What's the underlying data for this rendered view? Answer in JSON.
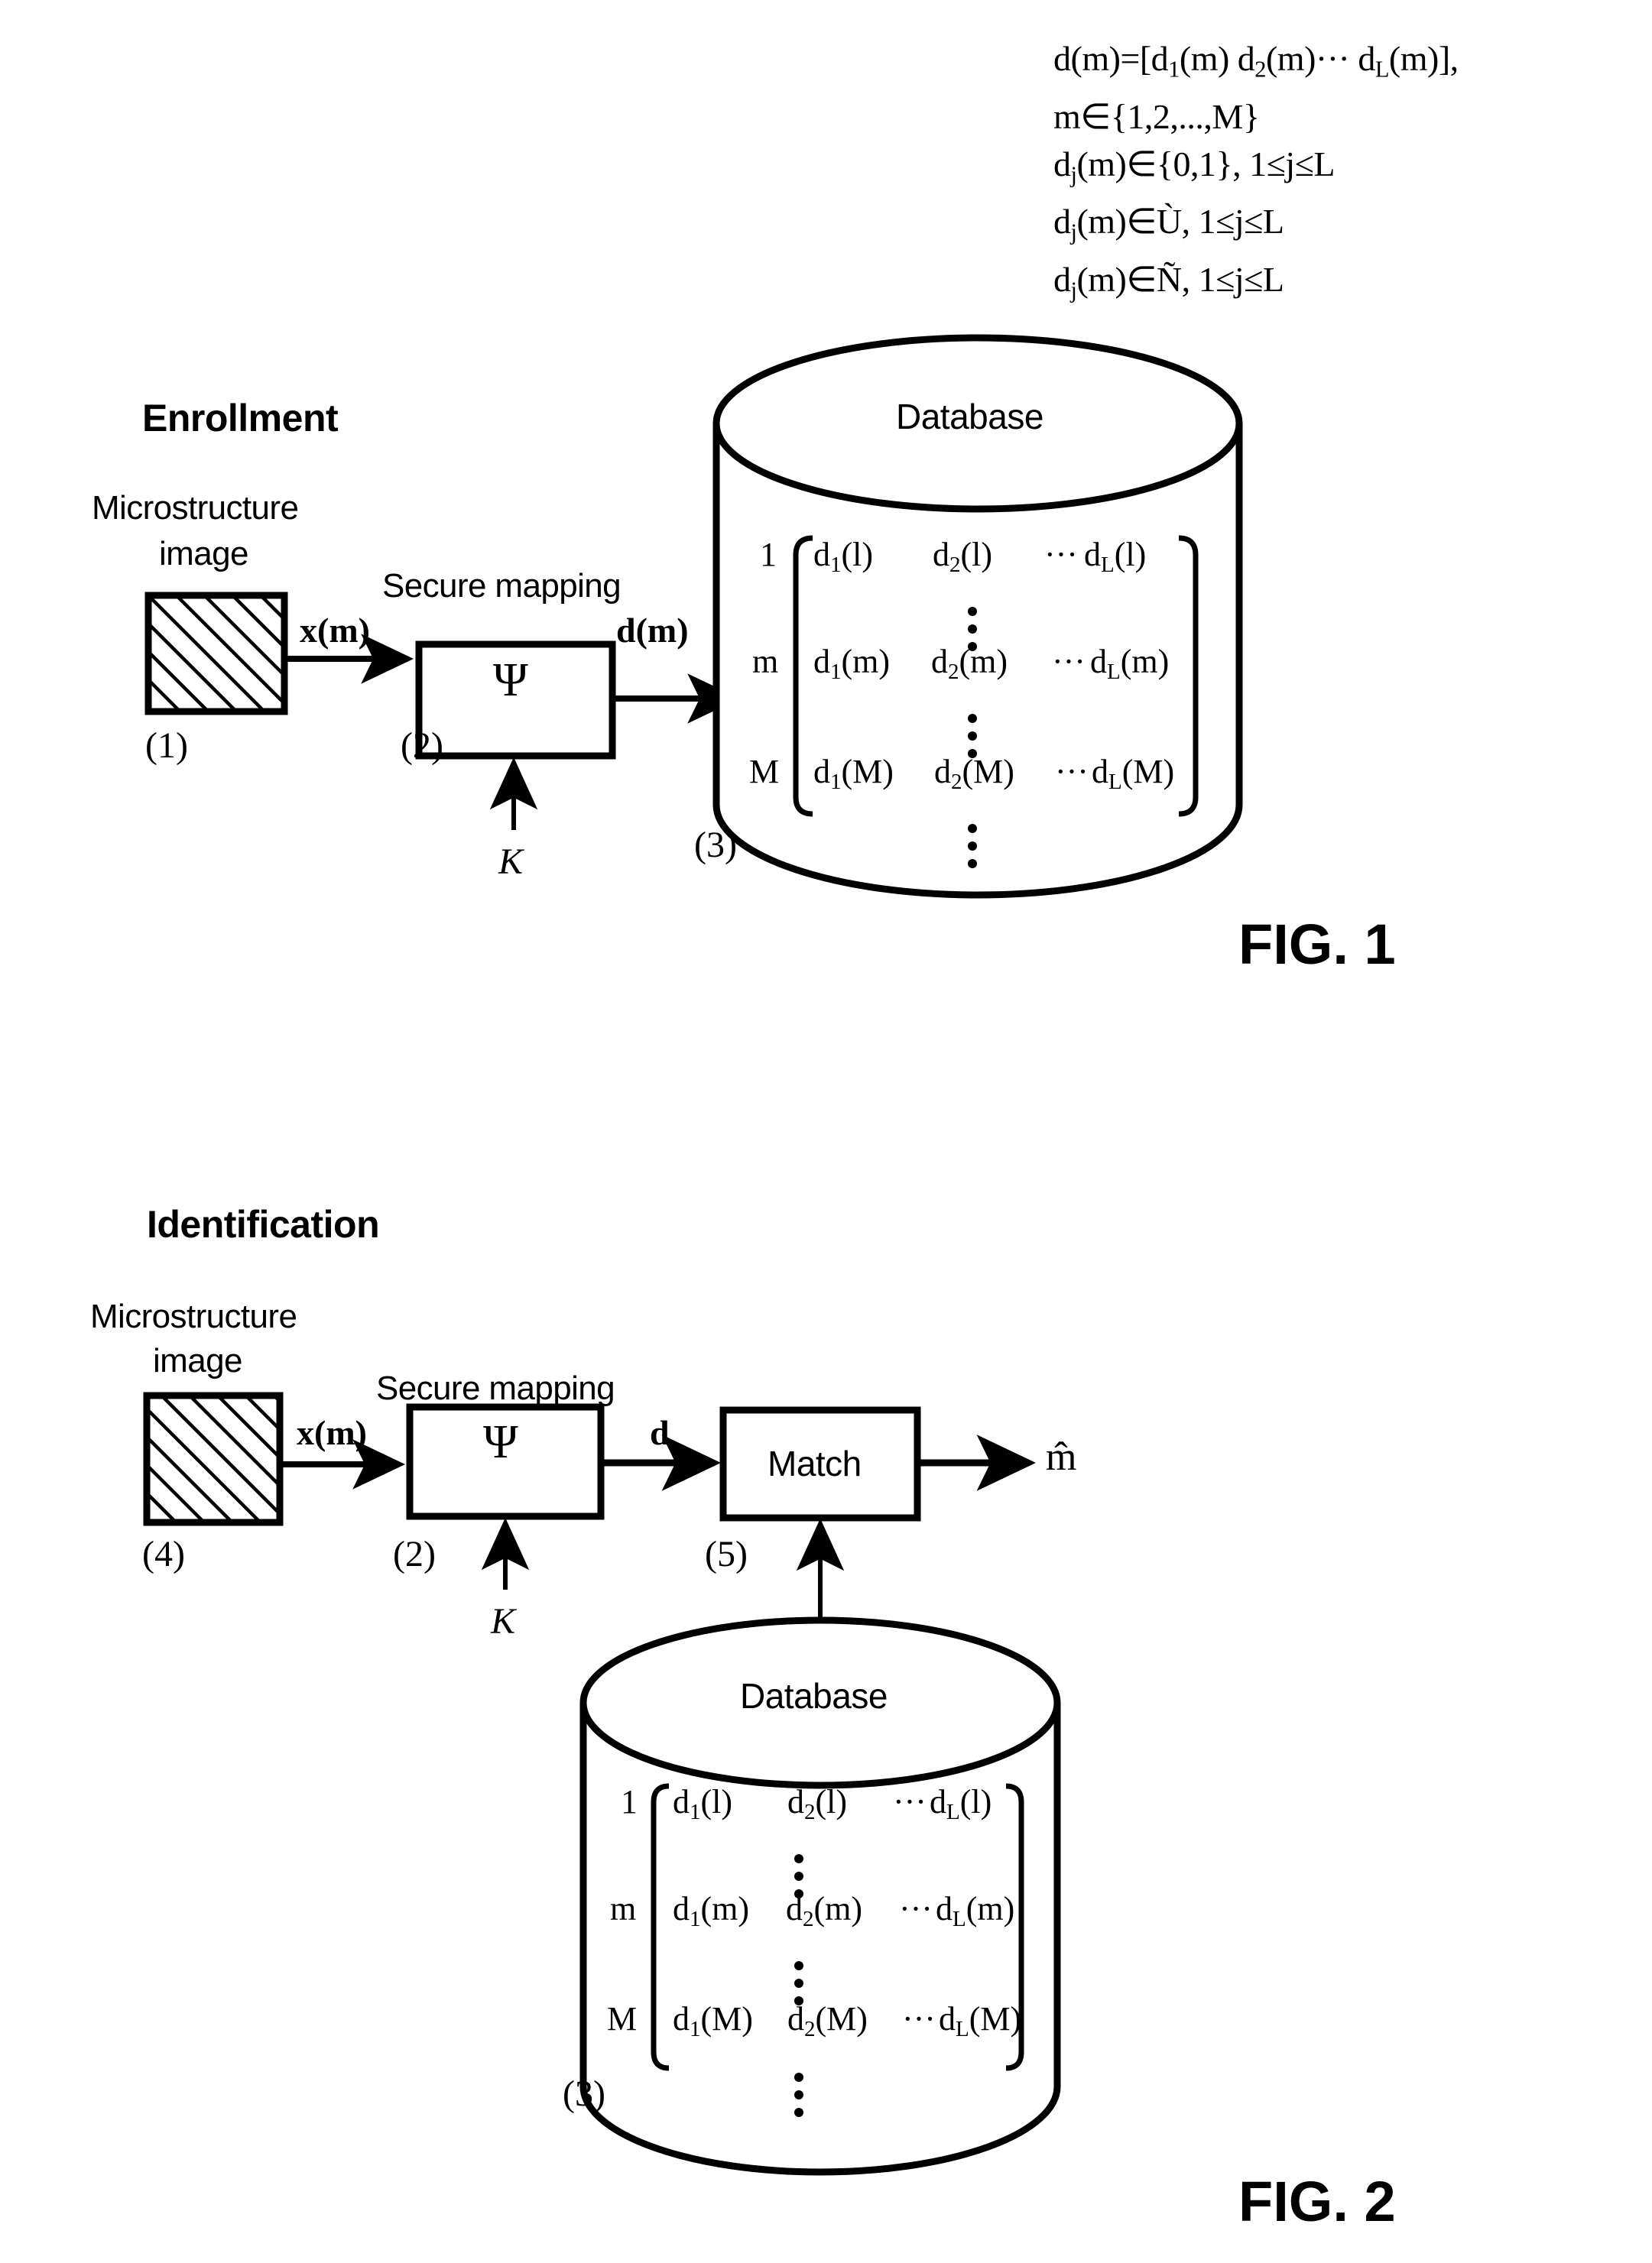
{
  "equations": [
    "d(m)=[d₁(m)  d₂(m)··· dₗ(m)],",
    "m∈{1,2,...,M}",
    "dⱼ(m)∈{0,1}, 1≤j≤L",
    "dⱼ(m)∈Ù, 1≤j≤L",
    "dⱼ(m)∈Ñ, 1≤j≤L"
  ],
  "equations_parts": {
    "line1": {
      "pre": "d(m)=[d",
      "s1": "1",
      "mid1": "(m)  d",
      "s2": "2",
      "mid2": "(m)··· d",
      "s3": "L",
      "post": "(m)],"
    },
    "line2": "m∈{1,2,...,M}",
    "line3": {
      "pre": "d",
      "sub": "j",
      "post": "(m)∈{0,1}, 1≤j≤L"
    },
    "line4": {
      "pre": "d",
      "sub": "j",
      "post": "(m)∈Ù, 1≤j≤L"
    },
    "line5": {
      "pre": "d",
      "sub": "j",
      "post": "(m)∈Ñ, 1≤j≤L"
    }
  },
  "fig1": {
    "title": "Enrollment",
    "fig_label": "FIG. 1",
    "source_label_line1": "Microstructure",
    "source_label_line2": "image",
    "source_ref": "(1)",
    "mapping_label": "Secure mapping",
    "mapping_glyph": "Ψ",
    "mapping_ref": "(2)",
    "key_label": "K",
    "signal_in": "x(m)",
    "signal_out": "d(m)",
    "database_label": "Database",
    "database_ref": "(3)"
  },
  "fig2": {
    "title": "Identification",
    "fig_label": "FIG. 2",
    "source_label_line1": "Microstructure",
    "source_label_line2": "image",
    "source_ref": "(4)",
    "mapping_label": "Secure mapping",
    "mapping_glyph": "Ψ",
    "mapping_ref": "(2)",
    "key_label": "K",
    "signal_in": "x(m)",
    "signal_mid": "d",
    "match_label": "Match",
    "match_ref": "(5)",
    "output_label": "m̂",
    "output_base": "m",
    "output_accent": "ˆ",
    "database_label": "Database",
    "database_ref": "(3)"
  },
  "matrix": {
    "row_labels": [
      "1",
      "m",
      "M"
    ],
    "rows": [
      {
        "c1_pre": "d",
        "c1_sub": "1",
        "c1_post": "(l)",
        "c2_pre": "d",
        "c2_sub": "2",
        "c2_post": "(l)",
        "ell": "···",
        "c3_pre": "d",
        "c3_sub": "L",
        "c3_post": "(l)"
      },
      {
        "c1_pre": "d",
        "c1_sub": "1",
        "c1_post": "(m)",
        "c2_pre": "d",
        "c2_sub": "2",
        "c2_post": "(m)",
        "ell": "···",
        "c3_pre": "d",
        "c3_sub": "L",
        "c3_post": "(m)"
      },
      {
        "c1_pre": "d",
        "c1_sub": "1",
        "c1_post": "(M)",
        "c2_pre": "d",
        "c2_sub": "2",
        "c2_post": "(M)",
        "ell": "···",
        "c3_pre": "d",
        "c3_sub": "L",
        "c3_post": "(M)"
      }
    ],
    "vdots": "⋮"
  },
  "colors": {
    "ink": "#000000",
    "paper": "#ffffff"
  }
}
